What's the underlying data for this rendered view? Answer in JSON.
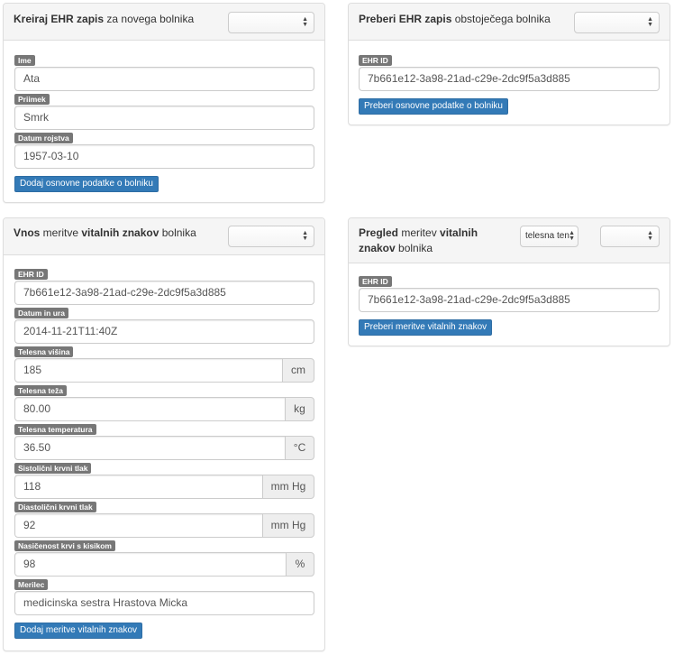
{
  "create_panel": {
    "title_bold": "Kreiraj EHR zapis",
    "title_rest": " za novega bolnika",
    "select_value": "",
    "fields": {
      "ime": {
        "label": "Ime",
        "value": "Ata"
      },
      "priimek": {
        "label": "Priimek",
        "value": "Smrk"
      },
      "datum_rojstva": {
        "label": "Datum rojstva",
        "value": "1957-03-10"
      }
    },
    "button_label": "Dodaj osnovne podatke o bolniku"
  },
  "fetch_panel": {
    "title_bold": "Preberi EHR zapis",
    "title_rest": " obstoječega bolnika",
    "select_value": "",
    "ehr_label": "EHR ID",
    "ehr_value": "7b661e12-3a98-21ad-c29e-2dc9f5a3d885",
    "button_label": "Preberi osnovne podatke o bolniku"
  },
  "vitals_panel": {
    "title_bold_1": "Vnos",
    "title_mid": " meritve ",
    "title_bold_2": "vitalnih znakov",
    "title_rest": " bolnika",
    "select_value": "",
    "fields": {
      "ehr_id": {
        "label": "EHR ID",
        "value": "7b661e12-3a98-21ad-c29e-2dc9f5a3d885"
      },
      "datum_ura": {
        "label": "Datum in ura",
        "value": "2014-11-21T11:40Z"
      },
      "visina": {
        "label": "Telesna višina",
        "value": "185",
        "unit": "cm"
      },
      "teza": {
        "label": "Telesna teža",
        "value": "80.00",
        "unit": "kg"
      },
      "temperatura": {
        "label": "Telesna temperatura",
        "value": "36.50",
        "unit": "°C"
      },
      "sistolicni": {
        "label": "Sistolični krvni tlak",
        "value": "118",
        "unit": "mm Hg"
      },
      "diastolicni": {
        "label": "Diastolični krvni tlak",
        "value": "92",
        "unit": "mm Hg"
      },
      "nasicenost": {
        "label": "Nasičenost krvi s kisikom",
        "value": "98",
        "unit": "%"
      },
      "merilec": {
        "label": "Merilec",
        "value": "medicinska sestra Hrastova Micka"
      }
    },
    "button_label": "Dodaj meritve vitalnih znakov"
  },
  "review_panel": {
    "title_bold_1": "Pregled",
    "title_mid": " meritev ",
    "title_bold_2": "vitalnih",
    "title_bold_3": "znakov",
    "title_rest": " bolnika",
    "type_select_value": "telesna ten",
    "select_value": "",
    "ehr_label": "EHR ID",
    "ehr_value": "7b661e12-3a98-21ad-c29e-2dc9f5a3d885",
    "button_label": "Preberi meritve vitalnih znakov"
  }
}
